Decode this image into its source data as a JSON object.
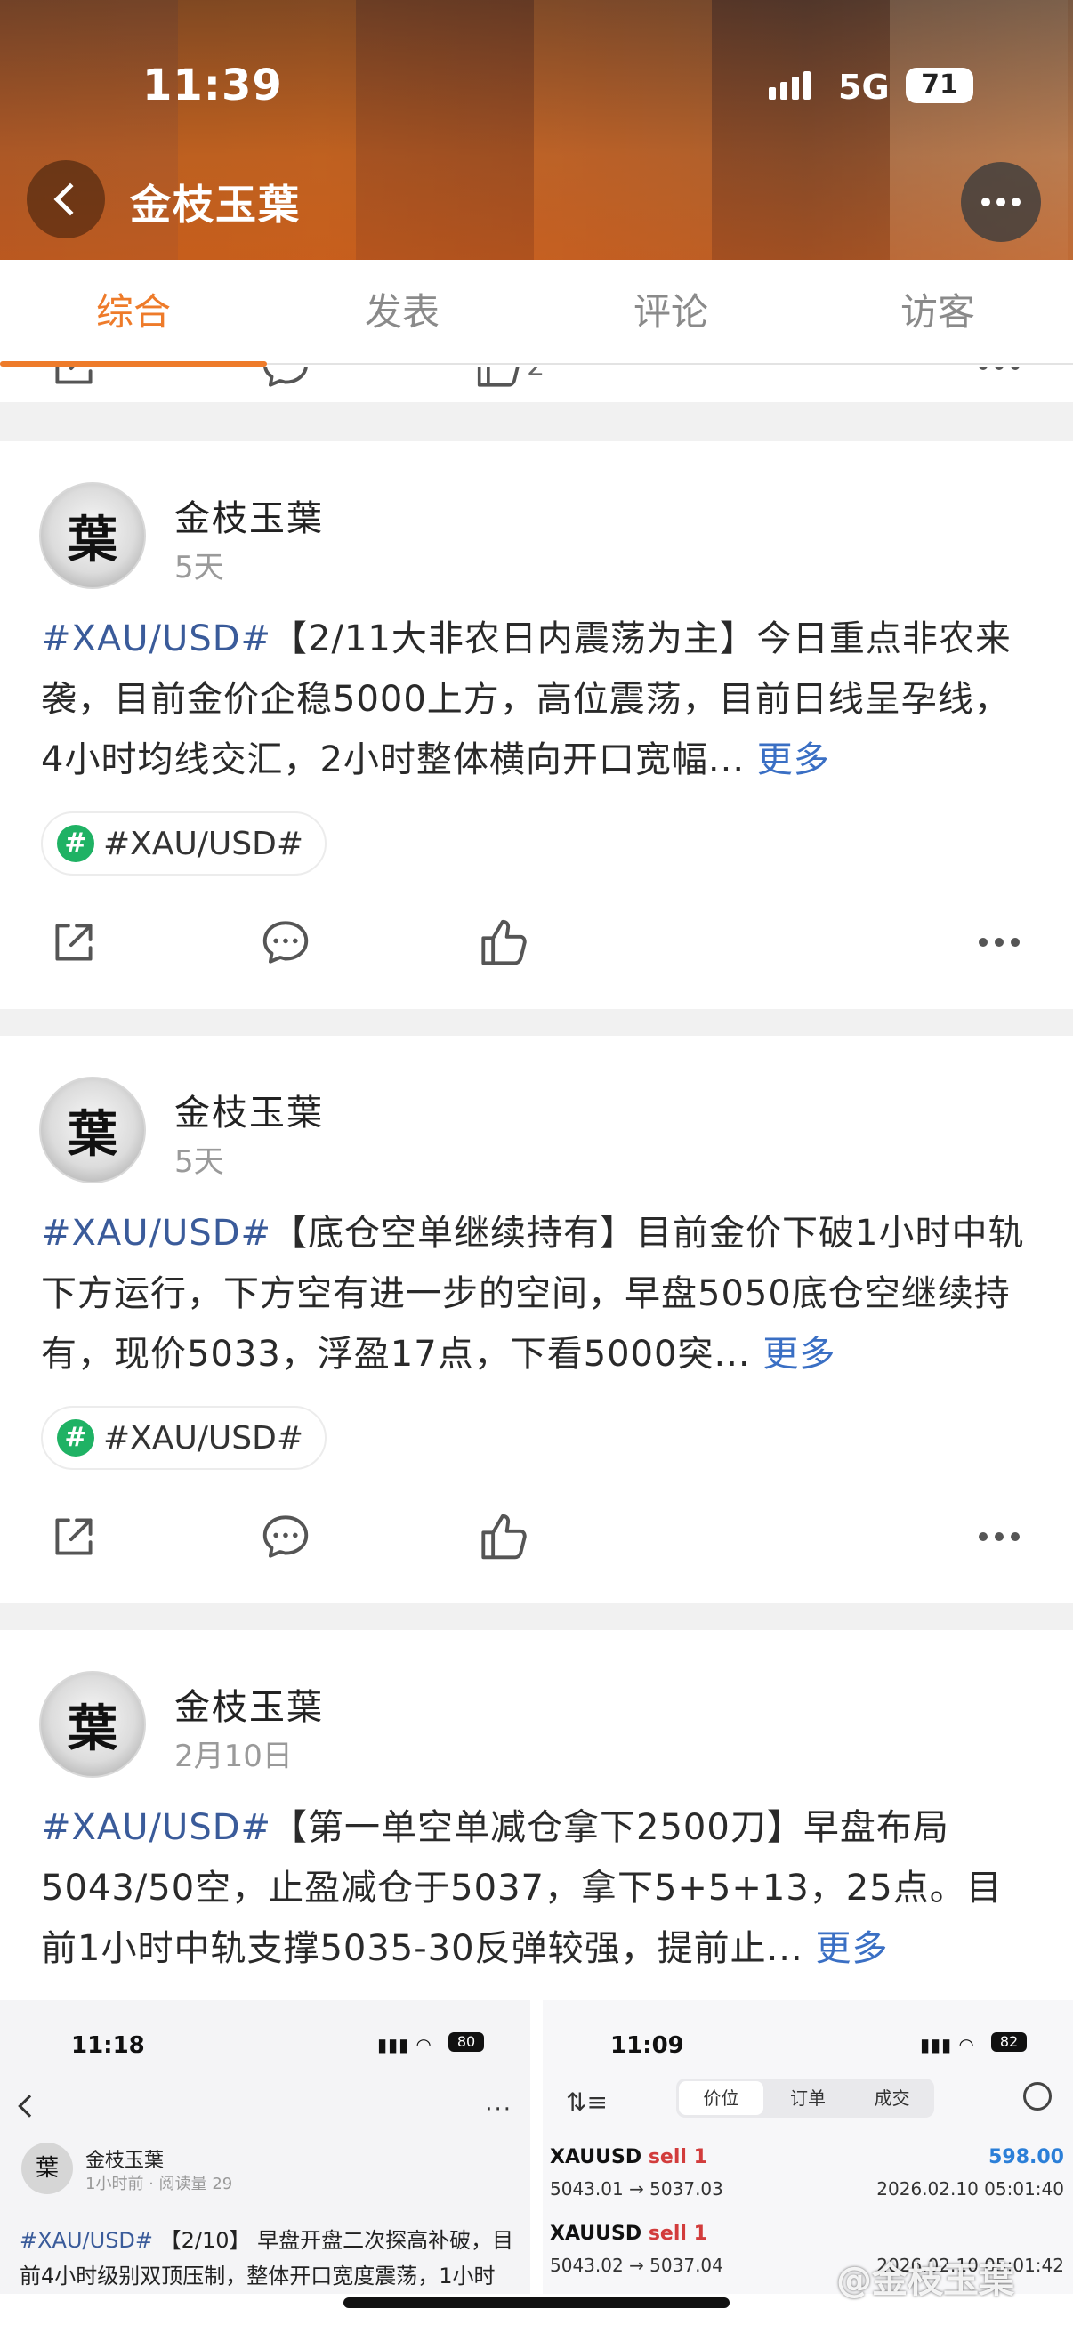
{
  "status": {
    "time": "11:39",
    "network": "5G",
    "battery": "71"
  },
  "nav": {
    "title": "金枝玉葉"
  },
  "tabs": [
    {
      "label": "综合",
      "active": true
    },
    {
      "label": "发表",
      "active": false
    },
    {
      "label": "评论",
      "active": false
    },
    {
      "label": "访客",
      "active": false
    }
  ],
  "partial_like_count": "2",
  "posts": [
    {
      "author": "金枝玉葉",
      "time": "5天",
      "hashtag": "#XAU/USD#",
      "text": "【2/11大非农日内震荡为主】今日重点非农来袭，目前金价企稳5000上方，高位震荡，目前日线呈孕线，4小时均线交汇，2小时整体横向开口宽幅...",
      "more": "更多",
      "topic": "#XAU/USD#"
    },
    {
      "author": "金枝玉葉",
      "time": "5天",
      "hashtag": "#XAU/USD#",
      "text": "【底仓空单继续持有】目前金价下破1小时中轨下方运行，下方空有进一步的空间，早盘5050底仓空继续持有，现价5033，浮盈17点，下看5000突...",
      "more": "更多",
      "topic": "#XAU/USD#"
    },
    {
      "author": "金枝玉葉",
      "time": "2月10日",
      "hashtag": "#XAU/USD#",
      "text": "【第一单空单减仓拿下2500刀】早盘布局5043/50空，止盈减仓于5037，拿下5+5+13，25点。目前1小时中轨支撑5035-30反弹较强，提前止...",
      "more": "更多"
    }
  ],
  "thumb_left": {
    "time": "11:18",
    "battery": "80",
    "author": "金枝玉葉",
    "meta": "1小时前 · 阅读量 29",
    "hashtag": "#XAU/USD#",
    "text": "【2/10】 早盘开盘二次探高补破，目前4小时级别双顶压制，整体开口宽度震荡，1小时"
  },
  "thumb_right": {
    "time": "11:09",
    "battery": "82",
    "segments": [
      "价位",
      "订单",
      "成交"
    ],
    "trades": [
      {
        "symbol": "XAUUSD",
        "side": "sell 1",
        "pnl": "598.00",
        "prices": "5043.01 → 5037.03",
        "datetime": "2026.02.10 05:01:40"
      },
      {
        "symbol": "XAUUSD",
        "side": "sell 1",
        "pnl": "",
        "prices": "5043.02 → 5037.04",
        "datetime": "2026.02.10 05:01:42"
      }
    ]
  },
  "watermark": "@金枝玉葉",
  "icons": {
    "share": "share-icon",
    "comment": "comment-icon",
    "like": "thumbs-up-icon",
    "more": "more-dots-icon"
  },
  "colors": {
    "accent": "#ee7b2a",
    "hashtag": "#3a5b9a",
    "more_link": "#3a6fc4",
    "topic_badge": "#1fb264",
    "sell": "#d23c3c",
    "profit": "#2b7fd8"
  }
}
